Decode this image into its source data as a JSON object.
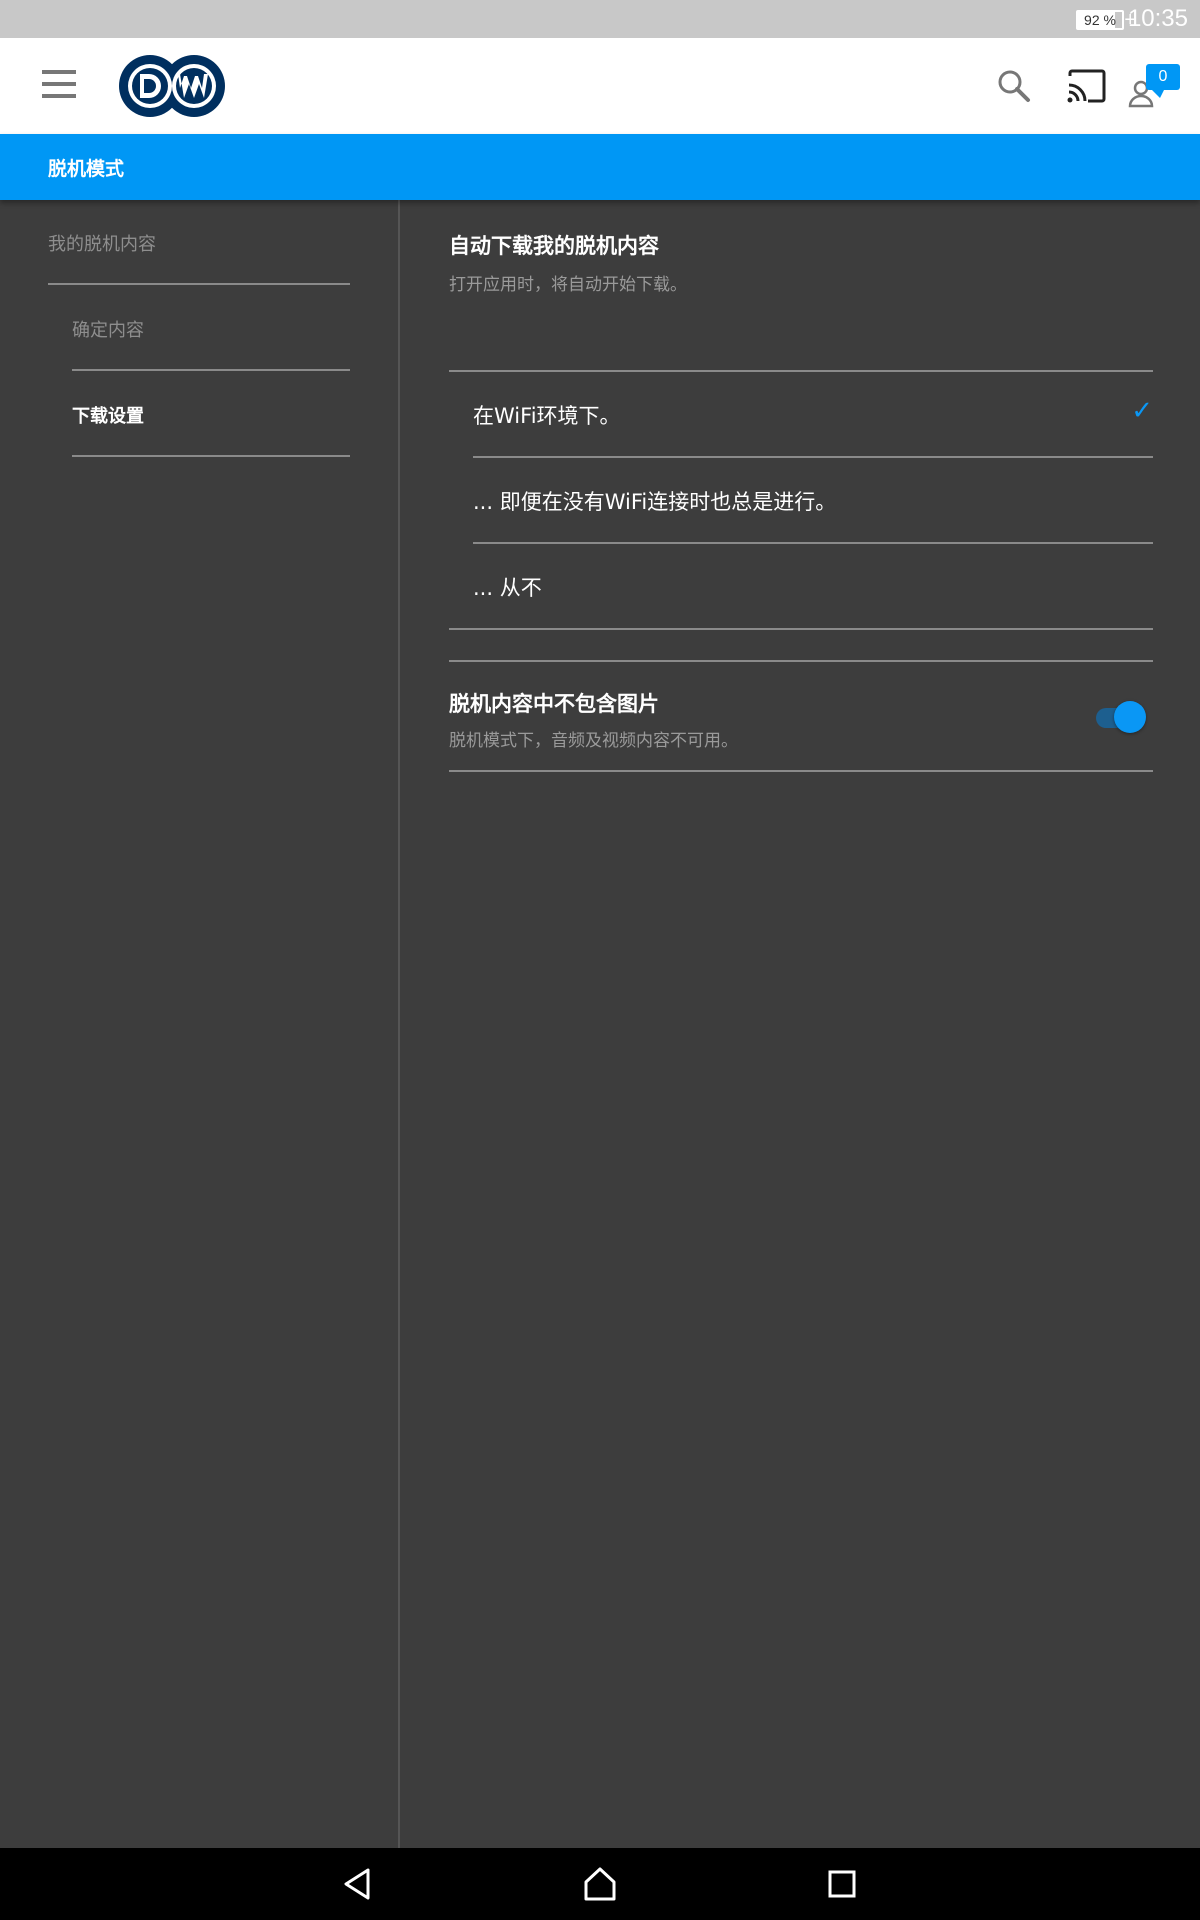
{
  "status_bar": {
    "battery": "92 %",
    "time": "10:35"
  },
  "app_bar": {
    "logo_text": "DW",
    "notification_count": "0"
  },
  "section": {
    "title": "脱机模式"
  },
  "left_nav": {
    "items": [
      {
        "label": "我的脱机内容"
      },
      {
        "label": "确定内容"
      },
      {
        "label": "下载设置"
      }
    ]
  },
  "auto_download": {
    "title": "自动下载我的脱机内容",
    "subtitle": "打开应用时，将自动开始下载。",
    "options": [
      {
        "label": "在WiFi环境下。",
        "selected": true
      },
      {
        "label": "... 即便在没有WiFi连接时也总是进行。",
        "selected": false
      },
      {
        "label": "... 从不",
        "selected": false
      }
    ]
  },
  "no_images": {
    "title": "脱机内容中不包含图片",
    "subtitle": "脱机模式下，音频及视频内容不可用。",
    "enabled": true
  },
  "colors": {
    "accent": "#0097f5",
    "background": "#3d3d3d",
    "logo": "#002f5f"
  }
}
